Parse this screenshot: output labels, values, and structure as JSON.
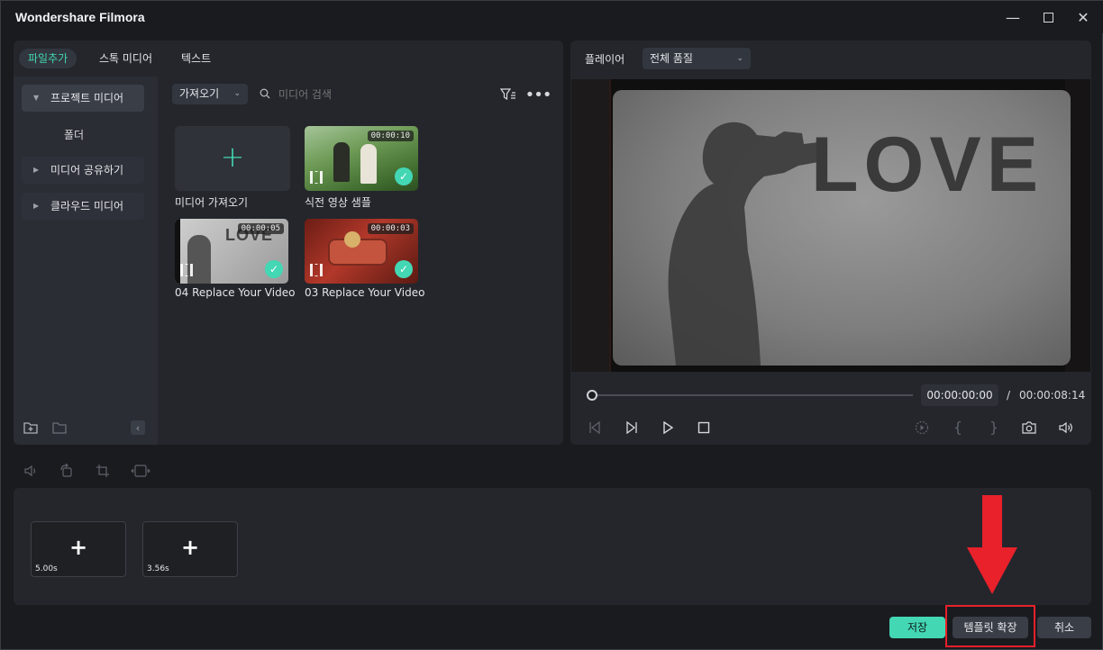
{
  "window": {
    "title": "Wondershare Filmora"
  },
  "media_panel": {
    "tabs": [
      {
        "label": "파일추가"
      },
      {
        "label": "스톡 미디어"
      },
      {
        "label": "텍스트"
      }
    ],
    "sidebar": [
      {
        "label": "프로젝트 미디어"
      },
      {
        "label": "폴더"
      },
      {
        "label": "미디어 공유하기"
      },
      {
        "label": "클라우드 미디어"
      }
    ],
    "import_dropdown": "가져오기",
    "search_placeholder": "미디어 검색",
    "import_tile_label": "미디어 가져오기",
    "items": [
      {
        "name": "식전 영상 샘플",
        "duration": "00:00:10"
      },
      {
        "name": "04 Replace Your Video",
        "duration": "00:00:05"
      },
      {
        "name": "03 Replace Your Video",
        "duration": "00:00:03"
      }
    ]
  },
  "player": {
    "label": "플레이어",
    "quality": "전체 품질",
    "current_time": "00:00:00:00",
    "separator": "/",
    "total_time": "00:00:08:14",
    "preview_text": "LOVE",
    "progress": 0
  },
  "timeline": {
    "slots": [
      {
        "duration": "5.00s"
      },
      {
        "duration": "3.56s"
      }
    ]
  },
  "footer": {
    "save": "저장",
    "expand_template": "템플릿 확장",
    "cancel": "취소"
  },
  "colors": {
    "accent": "#43d7b4",
    "highlight": "#e8212b"
  }
}
